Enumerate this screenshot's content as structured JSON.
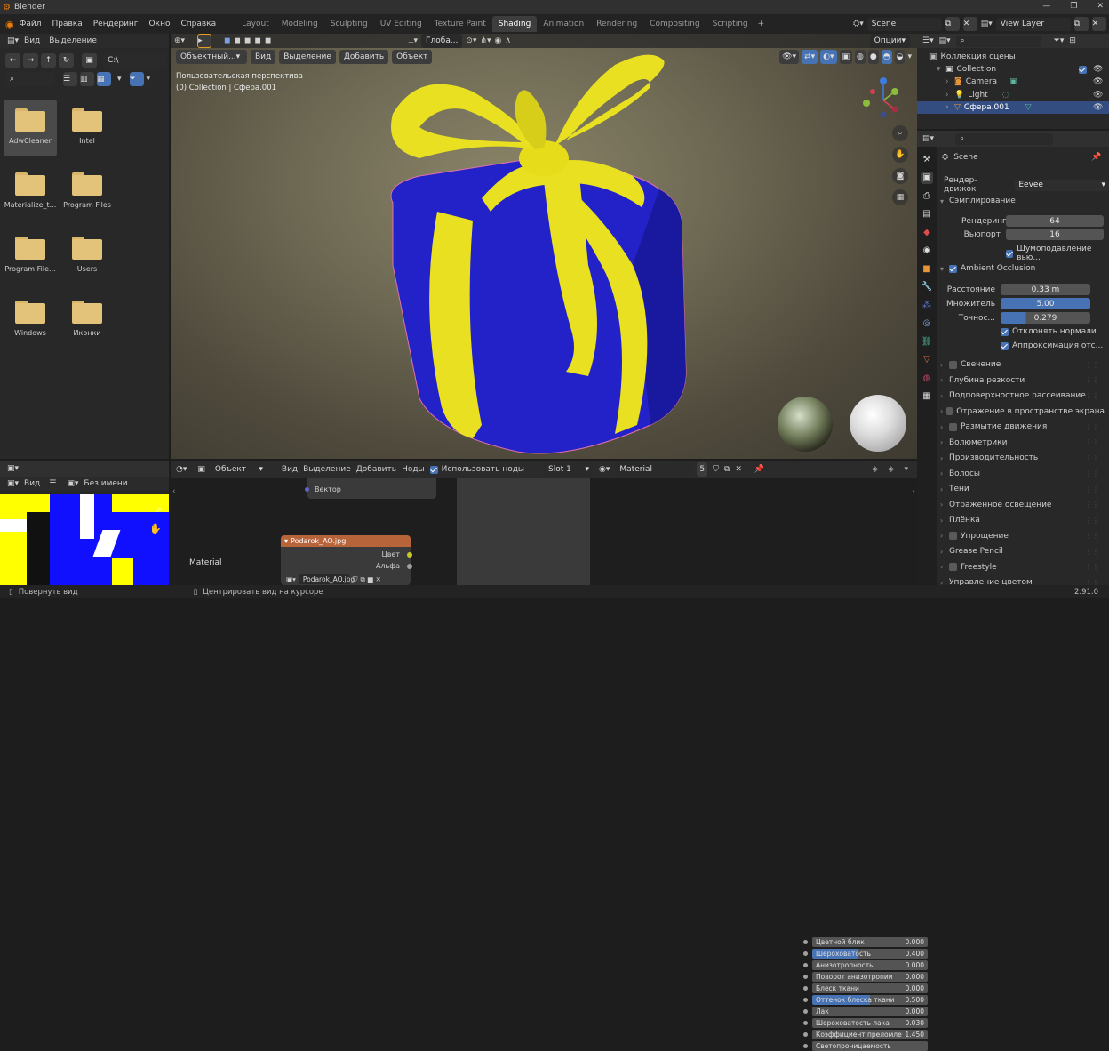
{
  "title": "Blender",
  "menu": [
    "Файл",
    "Правка",
    "Рендеринг",
    "Окно",
    "Справка"
  ],
  "workspace_tabs": [
    "Layout",
    "Modeling",
    "Sculpting",
    "UV Editing",
    "Texture Paint",
    "Shading",
    "Animation",
    "Rendering",
    "Compositing",
    "Scripting"
  ],
  "active_tab": "Shading",
  "scene": "Scene",
  "view_layer": "View Layer",
  "file_browser": {
    "menu": [
      "Вид",
      "Выделение"
    ],
    "path": "C:\\",
    "folders": [
      "AdwCleaner",
      "Intel",
      "Materialize_t...",
      "Program Files",
      "Program File...",
      "Users",
      "Windows",
      "Иконки"
    ]
  },
  "image_editor": {
    "view": "Вид",
    "image_name": "Без имени"
  },
  "viewport": {
    "mode": "Объектный...",
    "menu": [
      "Вид",
      "Выделение",
      "Добавить",
      "Объект"
    ],
    "perspective": "Пользовательская перспектива",
    "collection_info": "(0) Collection | Сфера.001",
    "orientation": "Глоба...",
    "options": "Опции"
  },
  "node_editor": {
    "type": "Объект",
    "menu": [
      "Вид",
      "Выделение",
      "Добавить",
      "Ноды"
    ],
    "use_nodes": "Использовать ноды",
    "slot": "Slot 1",
    "material": "Material",
    "users": "5",
    "material_label": "Material",
    "vector_label": "Вектор",
    "image_node": {
      "title": "Podarok_AO.jpg",
      "out_color": "Цвет",
      "out_alpha": "Альфа",
      "file": "Podarok_AO.jpg"
    },
    "bsdf_rows": [
      {
        "label": "Цветной блик",
        "value": "0.000"
      },
      {
        "label": "Шероховатость",
        "value": "0.400"
      },
      {
        "label": "Анизотропность",
        "value": "0.000"
      },
      {
        "label": "Поворот анизотропии",
        "value": "0.000"
      },
      {
        "label": "Блеск ткани",
        "value": "0.000"
      },
      {
        "label": "Оттенок блеска ткани",
        "value": "0.500"
      },
      {
        "label": "Лак",
        "value": "0.000"
      },
      {
        "label": "Шероховатость лака",
        "value": "0.030"
      },
      {
        "label": "Коэффициент преломле",
        "value": "1.450"
      },
      {
        "label": "Светопроницаемость",
        "value": ""
      }
    ]
  },
  "outliner": {
    "header": "Коллекция сцены",
    "items": [
      {
        "label": "Collection"
      },
      {
        "label": "Camera"
      },
      {
        "label": "Light"
      },
      {
        "label": "Сфера.001"
      }
    ]
  },
  "properties": {
    "scene": "Scene",
    "render_engine_label": "Рендер-движок",
    "render_engine": "Eevee",
    "sampling": "Сэмплирование",
    "render_label": "Рендеринг",
    "render_value": "64",
    "viewport_label": "Вьюпорт",
    "viewport_value": "16",
    "denoise": "Шумоподавление вью...",
    "ao": "Ambient Occlusion",
    "distance_label": "Расстояние",
    "distance_value": "0.33 m",
    "factor_label": "Множитель",
    "factor_value": "5.00",
    "precision_label": "Точнос...",
    "precision_value": "0.279",
    "bent_normals": "Отклонять нормали",
    "bounce": "Аппроксимация отс...",
    "sections": [
      {
        "label": "Свечение",
        "check": true
      },
      {
        "label": "Глубина резкости",
        "check": false
      },
      {
        "label": "Подповерхностное рассеивание",
        "check": false
      },
      {
        "label": "Отражение в пространстве экрана",
        "check": true
      },
      {
        "label": "Размытие движения",
        "check": true
      },
      {
        "label": "Волюметрики",
        "check": false
      },
      {
        "label": "Производительность",
        "check": false
      },
      {
        "label": "Волосы",
        "check": false
      },
      {
        "label": "Тени",
        "check": false
      },
      {
        "label": "Отражённое освещение",
        "check": false
      },
      {
        "label": "Плёнка",
        "check": false
      },
      {
        "label": "Упрощение",
        "check": true
      },
      {
        "label": "Grease Pencil",
        "check": false
      },
      {
        "label": "Freestyle",
        "check": true
      },
      {
        "label": "Управление цветом",
        "check": false
      }
    ]
  },
  "statusbar": {
    "left": "Повернуть вид",
    "middle": "Центрировать вид на курсоре",
    "version": "2.91.0"
  },
  "colors": {
    "accent": "#4772b3",
    "gift_blue": "#1f1fbf",
    "ribbon": "#e8e020"
  }
}
